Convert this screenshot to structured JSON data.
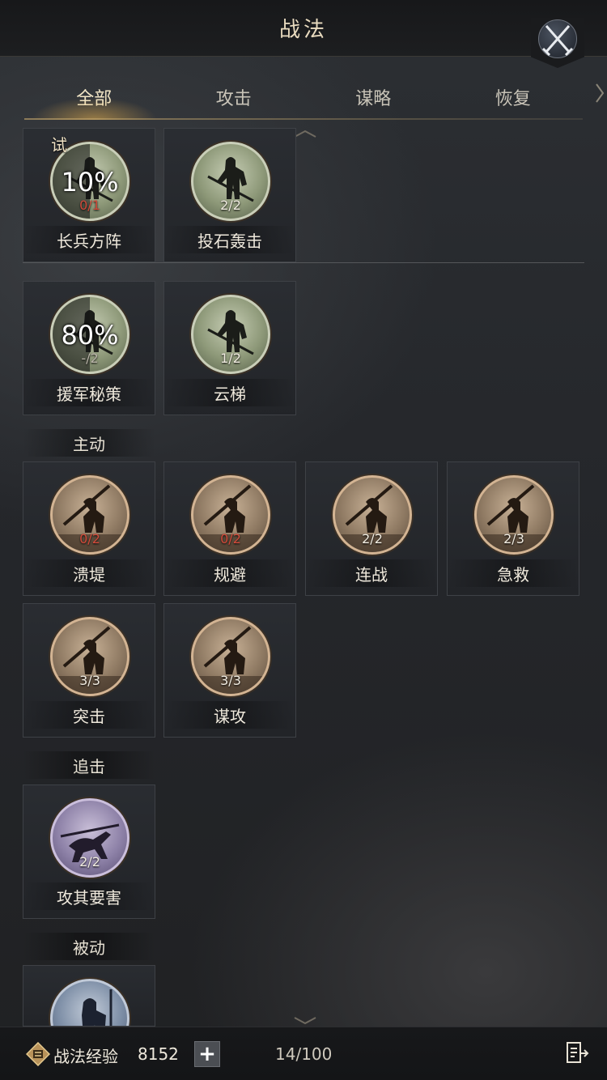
{
  "header": {
    "title": "战法"
  },
  "tabs": [
    {
      "label": "全部",
      "active": true
    },
    {
      "label": "攻击",
      "active": false
    },
    {
      "label": "谋略",
      "active": false
    },
    {
      "label": "恢复",
      "active": false
    }
  ],
  "trial_section": {
    "cards": [
      {
        "name": "长兵方阵",
        "count": "0/1",
        "trial_tag": "试",
        "progress_text": "10%",
        "progress": 0.1,
        "medal": "green",
        "count_color": "red"
      },
      {
        "name": "投石轰击",
        "count": "2/2",
        "medal": "green"
      }
    ]
  },
  "upgrade_section": {
    "cards": [
      {
        "name": "援军秘策",
        "count": "-/2",
        "progress_text": "80%",
        "progress": 0.8,
        "medal": "green"
      },
      {
        "name": "云梯",
        "count": "1/2",
        "medal": "green"
      }
    ]
  },
  "active_section": {
    "label": "主动",
    "cards": [
      {
        "name": "溃堤",
        "count": "0/2",
        "medal": "tan",
        "count_color": "red"
      },
      {
        "name": "规避",
        "count": "0/2",
        "medal": "tan",
        "count_color": "red"
      },
      {
        "name": "连战",
        "count": "2/2",
        "medal": "tan"
      },
      {
        "name": "急救",
        "count": "2/3",
        "medal": "tan"
      },
      {
        "name": "突击",
        "count": "3/3",
        "medal": "tan"
      },
      {
        "name": "谋攻",
        "count": "3/3",
        "medal": "tan"
      }
    ]
  },
  "pursuit_section": {
    "label": "追击",
    "cards": [
      {
        "name": "攻其要害",
        "count": "2/2",
        "medal": "purple"
      }
    ]
  },
  "passive_section": {
    "label": "被动",
    "cards": [
      {
        "name": "",
        "count": "",
        "medal": "blue"
      }
    ]
  },
  "footer": {
    "exp_label": "战法经验",
    "exp_value": "8152",
    "plus_label": "+",
    "capacity": "14/100"
  },
  "colors": {
    "gold_text": "#eadcc0",
    "red_count": "#d04a3a",
    "tab_glow": "#ebb450"
  }
}
